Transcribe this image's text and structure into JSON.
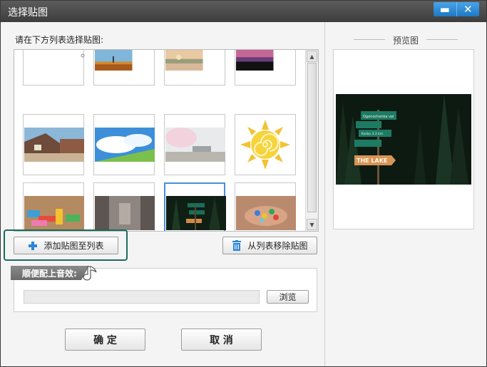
{
  "window": {
    "title": "选择贴图",
    "min_glyph": "▬",
    "close_glyph": "✕"
  },
  "list": {
    "label": "请在下方列表选择贴图:",
    "scroll_up_glyph": "▲",
    "scroll_down_glyph": "▼",
    "thumbnails": [
      {
        "subject": "blank white sticker"
      },
      {
        "subject": "autumn lake scene"
      },
      {
        "subject": "lakeside sunset"
      },
      {
        "subject": "purple dusk silhouette"
      },
      {
        "subject": "anime village street"
      },
      {
        "subject": "anime cloud sky"
      },
      {
        "subject": "cherry blossom scene"
      },
      {
        "subject": "cartoon sun"
      },
      {
        "subject": "colorful wooden blocks"
      },
      {
        "subject": "shadowed pavement"
      },
      {
        "subject": "forest signpost",
        "selected": true
      },
      {
        "subject": "hands holding marbles"
      }
    ]
  },
  "actions": {
    "add_label": "添加贴图至列表",
    "remove_label": "从列表移除贴图"
  },
  "music": {
    "tab_label": "顺便配上音效:",
    "path_value": "",
    "browse_label": "浏览"
  },
  "footer": {
    "ok_label": "确 定",
    "cancel_label": "取 消"
  },
  "preview": {
    "title": "预览图",
    "sign_top": "Ogonochenka vel",
    "sign_mid": "Kosko 3.3 km",
    "sign_bottom": "THE LAKE"
  },
  "colors": {
    "titlebar": "#4a4a4a",
    "window_button": "#2b86d8",
    "selection_border": "#4a8fd6",
    "highlight_frame": "#1a6b5c",
    "accent_icon": "#2b86d8"
  }
}
